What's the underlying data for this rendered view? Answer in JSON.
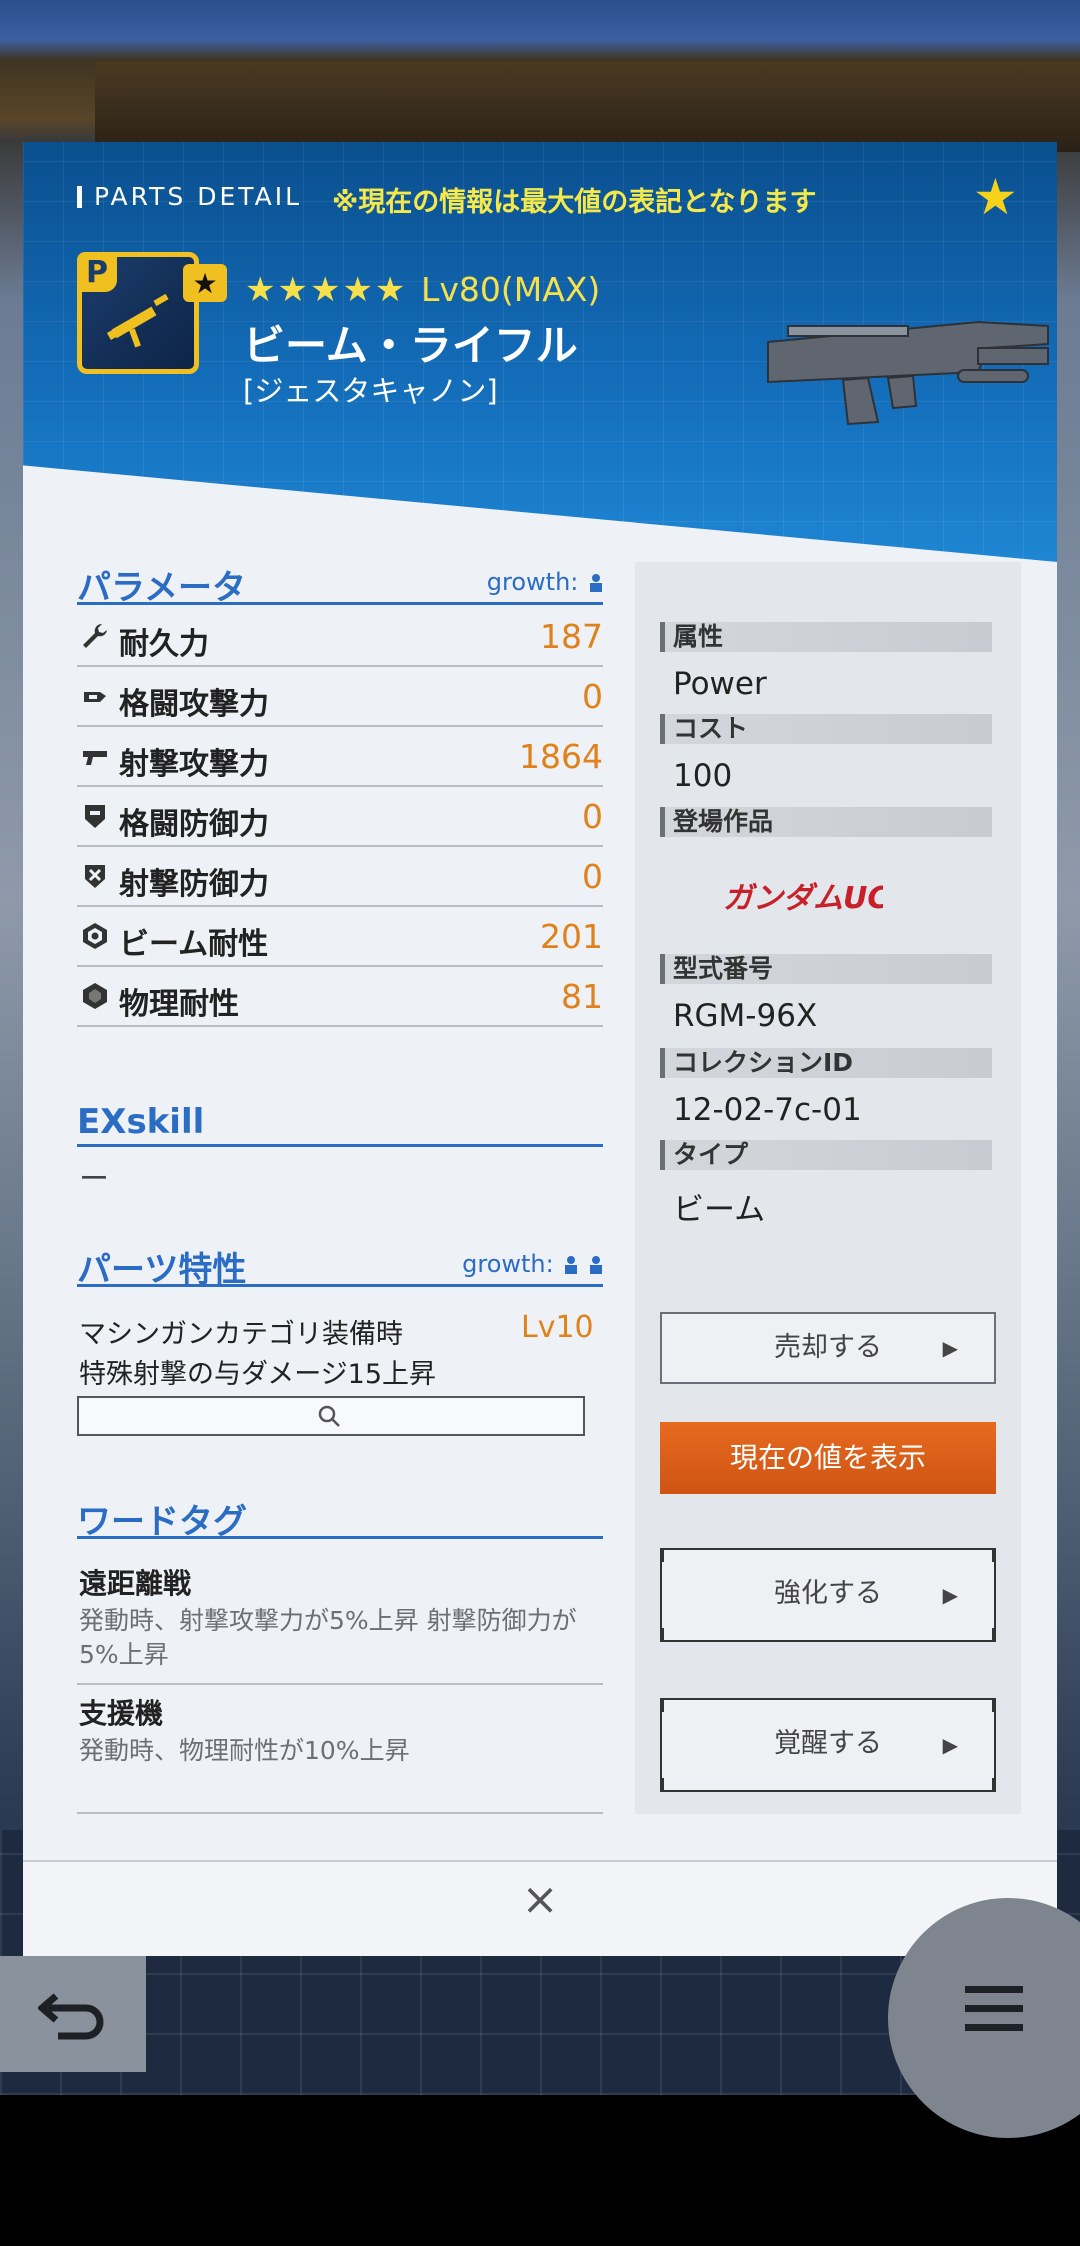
{
  "header": {
    "title": "PARTS DETAIL",
    "note": "※現在の情報は最大値の表記となります"
  },
  "part": {
    "rarity_stars": "★★★★★",
    "level": "Lv80(MAX)",
    "name": "ビーム・ライフル",
    "subname": "[ジェスタキャノン]",
    "icon_badge": "P",
    "accent": "#f0c020"
  },
  "parameters": {
    "title": "パラメータ",
    "growth_label": "growth:",
    "stats": [
      {
        "label": "耐久力",
        "value": "187",
        "icon": "wrench-icon"
      },
      {
        "label": "格闘攻撃力",
        "value": "0",
        "icon": "melee-attack-icon"
      },
      {
        "label": "射撃攻撃力",
        "value": "1864",
        "icon": "gun-icon"
      },
      {
        "label": "格闘防御力",
        "value": "0",
        "icon": "melee-defense-icon"
      },
      {
        "label": "射撃防御力",
        "value": "0",
        "icon": "shot-defense-icon"
      },
      {
        "label": "ビーム耐性",
        "value": "201",
        "icon": "beam-resist-icon"
      },
      {
        "label": "物理耐性",
        "value": "81",
        "icon": "physical-resist-icon"
      }
    ]
  },
  "exskill": {
    "title": "EXskill",
    "value": "ー"
  },
  "traits": {
    "title": "パーツ特性",
    "growth_label": "growth:",
    "line1": "マシンガンカテゴリ装備時",
    "line2": "特殊射撃の与ダメージ15上昇",
    "level": "Lv10"
  },
  "word_tags": {
    "title": "ワードタグ",
    "items": [
      {
        "name": "遠距離戦",
        "desc": "発動時、射撃攻撃力が5%上昇 射撃防御力が5%上昇"
      },
      {
        "name": "支援機",
        "desc": "発動時、物理耐性が10%上昇"
      }
    ]
  },
  "info": {
    "attribute_label": "属性",
    "attribute_value": "Power",
    "cost_label": "コスト",
    "cost_value": "100",
    "series_label": "登場作品",
    "series_logo": "ガンダムUC",
    "model_label": "型式番号",
    "model_value": "RGM-96X",
    "collection_label": "コレクションID",
    "collection_value": "12-02-7c-01",
    "type_label": "タイプ",
    "type_value": "ビーム"
  },
  "buttons": {
    "sell": "売却する",
    "show_current": "現在の値を表示",
    "enhance": "強化する",
    "awaken": "覚醒する",
    "close": "×",
    "back": "↩",
    "accent_orange": "#e66a1e"
  }
}
